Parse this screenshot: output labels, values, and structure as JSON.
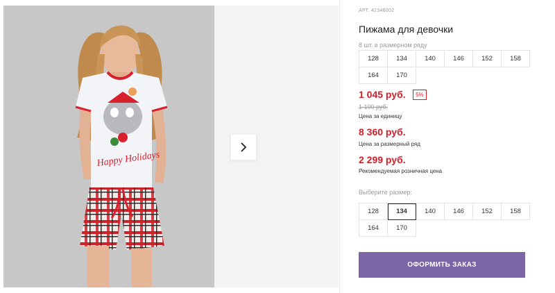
{
  "product": {
    "sku": "АРТ. 42346002",
    "title": "Пижама для девочки",
    "sizes_note": "8 шт. в размерном ряду",
    "size_row_sizes": [
      "128",
      "134",
      "140",
      "146",
      "152",
      "158",
      "164",
      "170"
    ],
    "price": "1 045 руб.",
    "discount_badge": "5%",
    "old_price": "1 100 руб.",
    "price_caption": "Цена за единицу",
    "row_price": "8 360 руб.",
    "row_price_caption": "Цена за размерный ряд",
    "retail_price": "2 299 руб.",
    "retail_price_caption": "Рекомендуемая розничная цена",
    "select_size_label": "Выберите размер:",
    "select_sizes": [
      "128",
      "134",
      "140",
      "146",
      "152",
      "158",
      "164",
      "170"
    ],
    "selected_size": "134",
    "order_button_label": "ОФОРМИТЬ ЗАКАЗ"
  },
  "photo": {
    "shirt_print_text": "Happy Holidays"
  },
  "colors": {
    "price_red": "#d0202c",
    "order_button": "#7b65a6"
  },
  "icons": {
    "next": "chevron-right-icon"
  }
}
